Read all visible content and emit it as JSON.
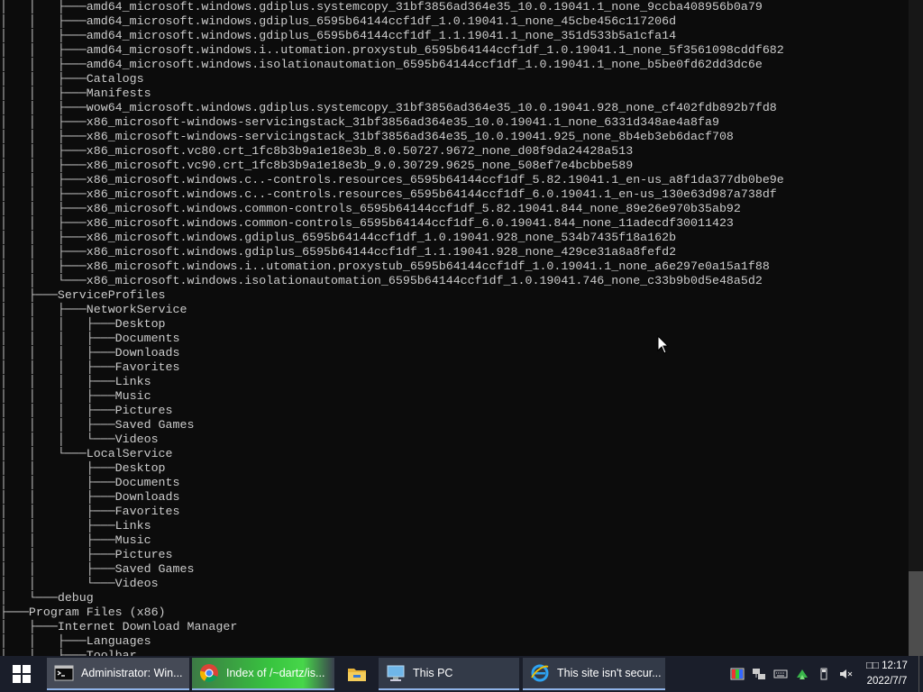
{
  "console": {
    "title": "Administrator: Windows PowerShell",
    "lines": [
      "│   │   ├───amd64_microsoft.windows.gdiplus.systemcopy_31bf3856ad364e35_10.0.19041.1_none_9ccba408956b0a79",
      "│   │   ├───amd64_microsoft.windows.gdiplus_6595b64144ccf1df_1.0.19041.1_none_45cbe456c117206d",
      "│   │   ├───amd64_microsoft.windows.gdiplus_6595b64144ccf1df_1.1.19041.1_none_351d533b5a1cfa14",
      "│   │   ├───amd64_microsoft.windows.i..utomation.proxystub_6595b64144ccf1df_1.0.19041.1_none_5f3561098cddf682",
      "│   │   ├───amd64_microsoft.windows.isolationautomation_6595b64144ccf1df_1.0.19041.1_none_b5be0fd62dd3dc6e",
      "│   │   ├───Catalogs",
      "│   │   ├───Manifests",
      "│   │   ├───wow64_microsoft.windows.gdiplus.systemcopy_31bf3856ad364e35_10.0.19041.928_none_cf402fdb892b7fd8",
      "│   │   ├───x86_microsoft-windows-servicingstack_31bf3856ad364e35_10.0.19041.1_none_6331d348ae4a8fa9",
      "│   │   ├───x86_microsoft-windows-servicingstack_31bf3856ad364e35_10.0.19041.925_none_8b4eb3eb6dacf708",
      "│   │   ├───x86_microsoft.vc80.crt_1fc8b3b9a1e18e3b_8.0.50727.9672_none_d08f9da24428a513",
      "│   │   ├───x86_microsoft.vc90.crt_1fc8b3b9a1e18e3b_9.0.30729.9625_none_508ef7e4bcbbe589",
      "│   │   ├───x86_microsoft.windows.c..-controls.resources_6595b64144ccf1df_5.82.19041.1_en-us_a8f1da377db0be9e",
      "│   │   ├───x86_microsoft.windows.c..-controls.resources_6595b64144ccf1df_6.0.19041.1_en-us_130e63d987a738df",
      "│   │   ├───x86_microsoft.windows.common-controls_6595b64144ccf1df_5.82.19041.844_none_89e26e970b35ab92",
      "│   │   ├───x86_microsoft.windows.common-controls_6595b64144ccf1df_6.0.19041.844_none_11adecdf30011423",
      "│   │   ├───x86_microsoft.windows.gdiplus_6595b64144ccf1df_1.0.19041.928_none_534b7435f18a162b",
      "│   │   ├───x86_microsoft.windows.gdiplus_6595b64144ccf1df_1.1.19041.928_none_429ce31a8a8fefd2",
      "│   │   ├───x86_microsoft.windows.i..utomation.proxystub_6595b64144ccf1df_1.0.19041.1_none_a6e297e0a15a1f88",
      "│   │   └───x86_microsoft.windows.isolationautomation_6595b64144ccf1df_1.0.19041.746_none_c33b9b0d5e48a5d2",
      "│   ├───ServiceProfiles",
      "│   │   ├───NetworkService",
      "│   │   │   ├───Desktop",
      "│   │   │   ├───Documents",
      "│   │   │   ├───Downloads",
      "│   │   │   ├───Favorites",
      "│   │   │   ├───Links",
      "│   │   │   ├───Music",
      "│   │   │   ├───Pictures",
      "│   │   │   ├───Saved Games",
      "│   │   │   └───Videos",
      "│   │   └───LocalService",
      "│   │       ├───Desktop",
      "│   │       ├───Documents",
      "│   │       ├───Downloads",
      "│   │       ├───Favorites",
      "│   │       ├───Links",
      "│   │       ├───Music",
      "│   │       ├───Pictures",
      "│   │       ├───Saved Games",
      "│   │       └───Videos",
      "│   └───debug",
      "├───Program Files (x86)",
      "│   ├───Internet Download Manager",
      "│   │   ├───Languages",
      "│   │   ├───Toolbar"
    ]
  },
  "taskbar": {
    "items": [
      {
        "label": "Administrator: Win...",
        "icon": "console-icon"
      },
      {
        "label": "Index of /~dartz/is...",
        "icon": "chrome-icon"
      },
      {
        "label": "",
        "icon": "file-explorer-icon"
      },
      {
        "label": "This PC",
        "icon": "this-pc-icon"
      },
      {
        "label": "This site isn't secur...",
        "icon": "internet-explorer-icon"
      }
    ],
    "tray_icons": [
      "color-tray-icon",
      "network-tray-icon",
      "keyboard-tray-icon",
      "green-arrow-tray-icon",
      "usb-drive-tray-icon",
      "volume-muted-icon"
    ],
    "clock": {
      "time": "□□ 12:17",
      "date": "2022/7/7"
    }
  },
  "scrollbar": {
    "position": 0.87
  }
}
